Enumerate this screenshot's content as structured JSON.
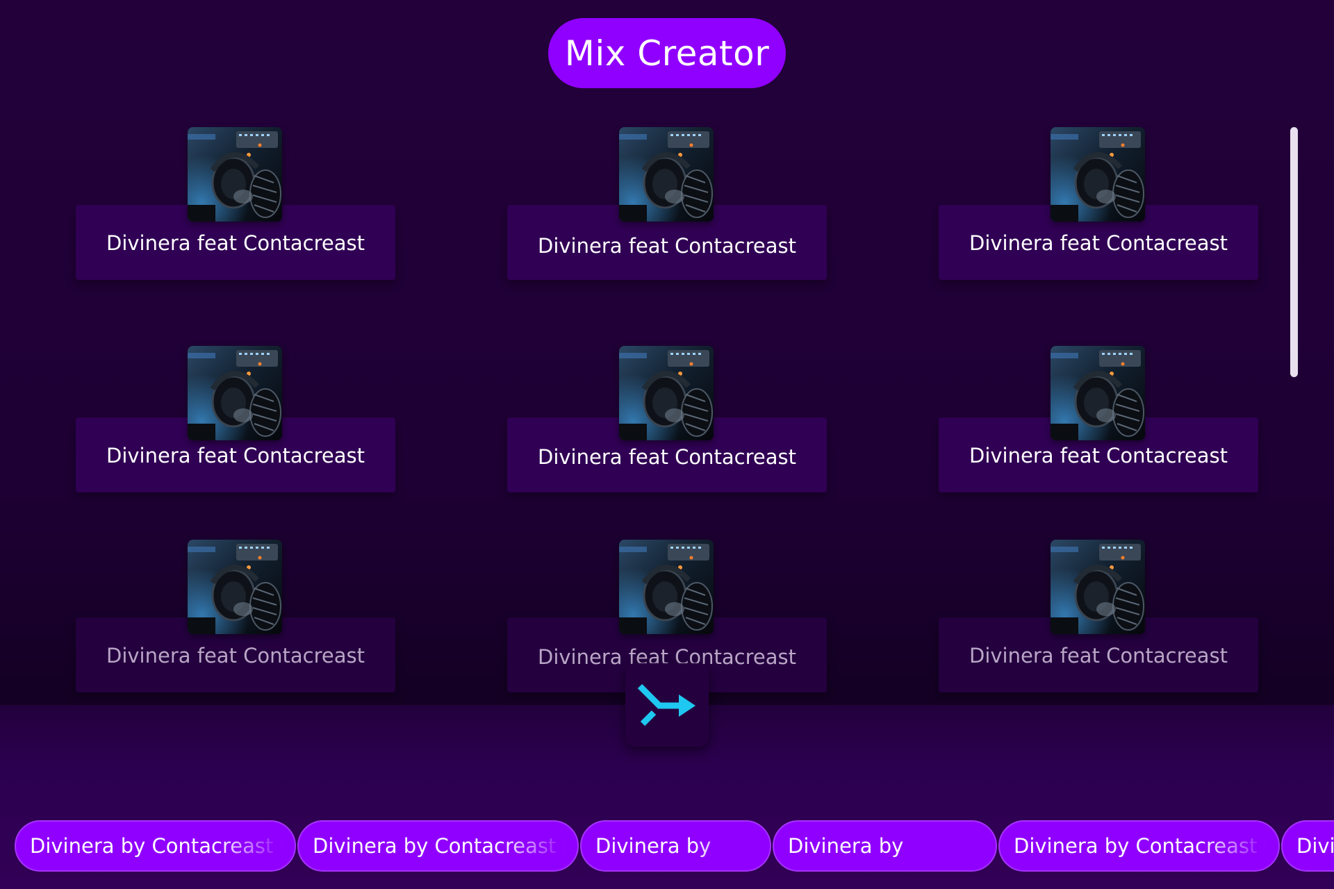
{
  "header": {
    "title": "Mix Creator"
  },
  "tracks": [
    {
      "title": "Divinera feat Contacreast",
      "art": "dj-headphones-artwork"
    },
    {
      "title": "Divinera feat Contacreast",
      "art": "dj-headphones-artwork"
    },
    {
      "title": "Divinera feat Contacreast",
      "art": "dj-headphones-artwork"
    },
    {
      "title": "Divinera feat Contacreast",
      "art": "dj-headphones-artwork"
    },
    {
      "title": "Divinera feat Contacreast",
      "art": "dj-headphones-artwork"
    },
    {
      "title": "Divinera feat Contacreast",
      "art": "dj-headphones-artwork"
    },
    {
      "title": "Divinera feat Contacreast",
      "art": "dj-headphones-artwork"
    },
    {
      "title": "Divinera feat Contacreast",
      "art": "dj-headphones-artwork"
    },
    {
      "title": "Divinera feat Contacreast",
      "art": "dj-headphones-artwork"
    }
  ],
  "dock": {
    "merge_button_icon": "merge-arrow-icon",
    "chips": [
      {
        "label": "Divinera by Contacreast ft"
      },
      {
        "label": "Divinera by Contacreast ft"
      },
      {
        "label": "Divinera by"
      },
      {
        "label": "Divinera by"
      },
      {
        "label": "Divinera by Contacreast ft"
      },
      {
        "label": "Divinera"
      }
    ]
  },
  "colors": {
    "accent": "#9000ff",
    "background": "#1e0034",
    "card": "#300054",
    "merge_icon": "#1fc8f0"
  }
}
